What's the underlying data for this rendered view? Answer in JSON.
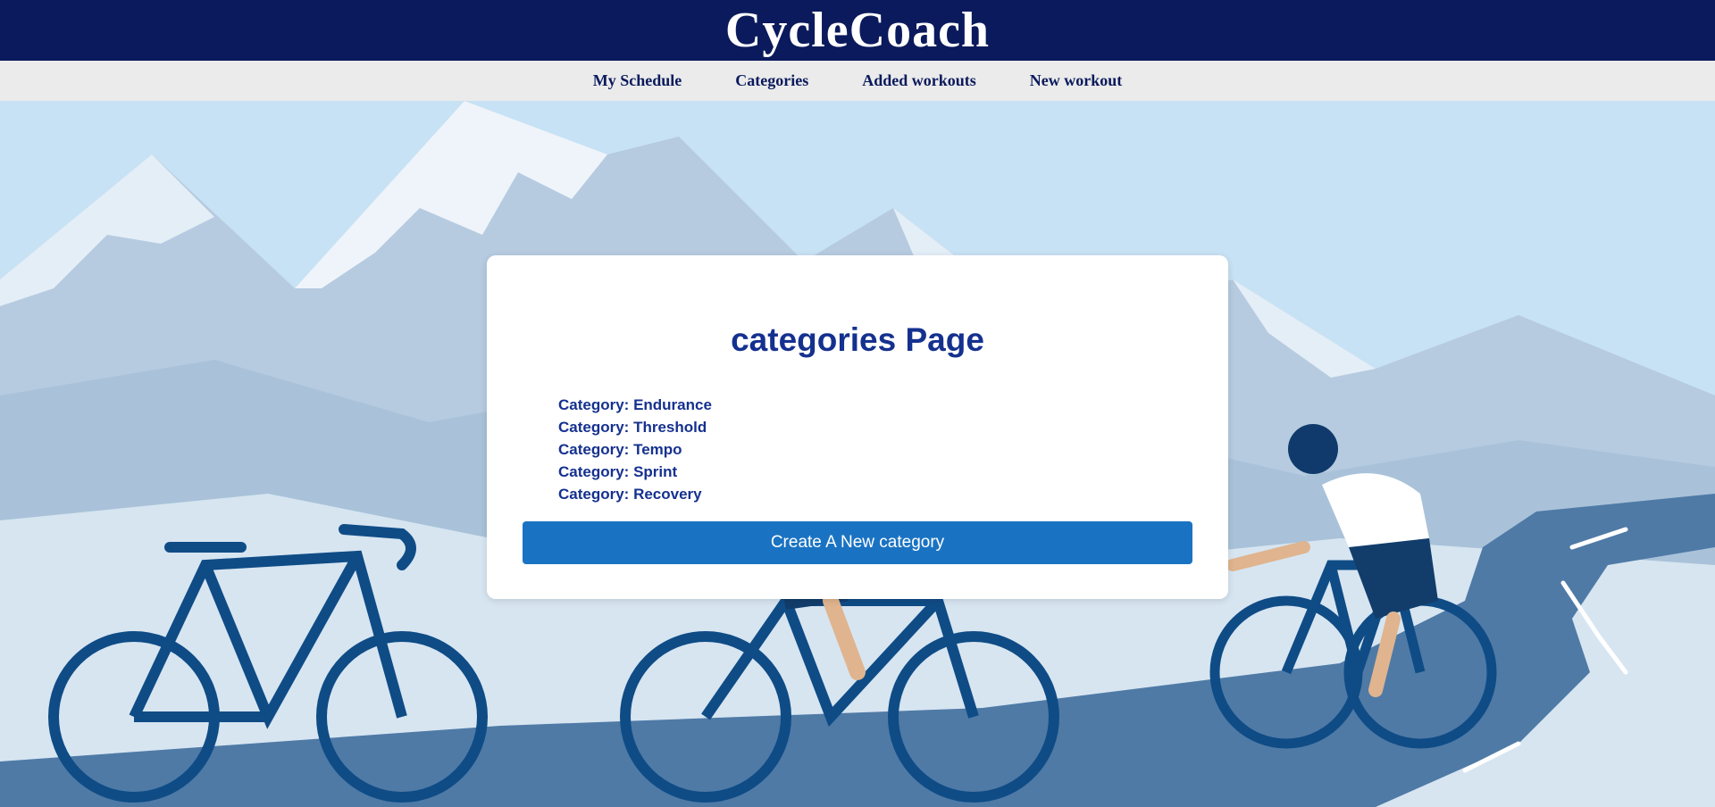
{
  "header": {
    "brand": "CycleCoach"
  },
  "nav": {
    "items": [
      {
        "label": "My Schedule"
      },
      {
        "label": "Categories"
      },
      {
        "label": "Added workouts"
      },
      {
        "label": "New workout"
      }
    ]
  },
  "main": {
    "title": "categories Page",
    "categories": [
      "Category: Endurance",
      "Category: Threshold",
      "Category: Tempo",
      "Category: Sprint",
      "Category: Recovery"
    ],
    "create_button_label": "Create A New category"
  },
  "colors": {
    "header_bg": "#0a1a5c",
    "nav_bg": "#ebebeb",
    "accent_text": "#15318f",
    "button_bg": "#1a73c2"
  }
}
